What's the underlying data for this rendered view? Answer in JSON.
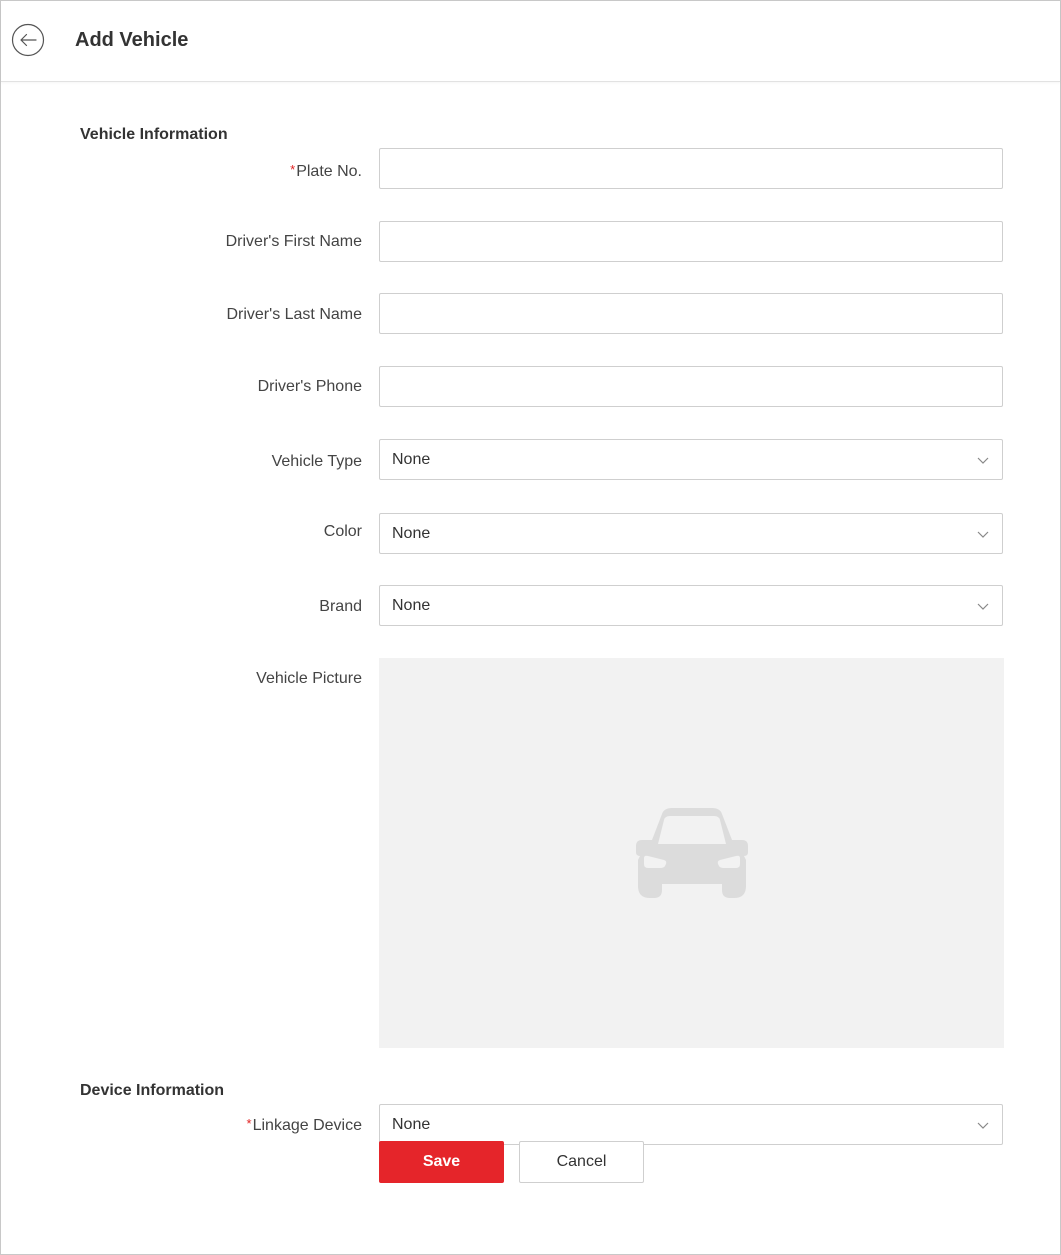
{
  "header": {
    "back_icon": "arrow-left-circle-icon",
    "title": "Add Vehicle"
  },
  "vehicle_section": {
    "title": "Vehicle Information",
    "plate": {
      "required_mark": "*",
      "label": "Plate No.",
      "value": ""
    },
    "first_name": {
      "label": "Driver's First Name",
      "value": ""
    },
    "last_name": {
      "label": "Driver's Last Name",
      "value": ""
    },
    "phone": {
      "label": "Driver's Phone",
      "value": ""
    },
    "vehicle_type": {
      "label": "Vehicle Type",
      "value": "None"
    },
    "color": {
      "label": "Color",
      "value": "None"
    },
    "brand": {
      "label": "Brand",
      "value": "None"
    },
    "picture": {
      "label": "Vehicle Picture",
      "placeholder_icon": "car-icon"
    }
  },
  "device_section": {
    "title": "Device Information",
    "linkage_device": {
      "required_mark": "*",
      "label": "Linkage Device",
      "value": "None"
    }
  },
  "actions": {
    "save_label": "Save",
    "cancel_label": "Cancel"
  },
  "colors": {
    "accent": "#e5252a",
    "required": "#e02020",
    "picture_bg": "#f2f2f2",
    "border": "#cfcfcf"
  }
}
